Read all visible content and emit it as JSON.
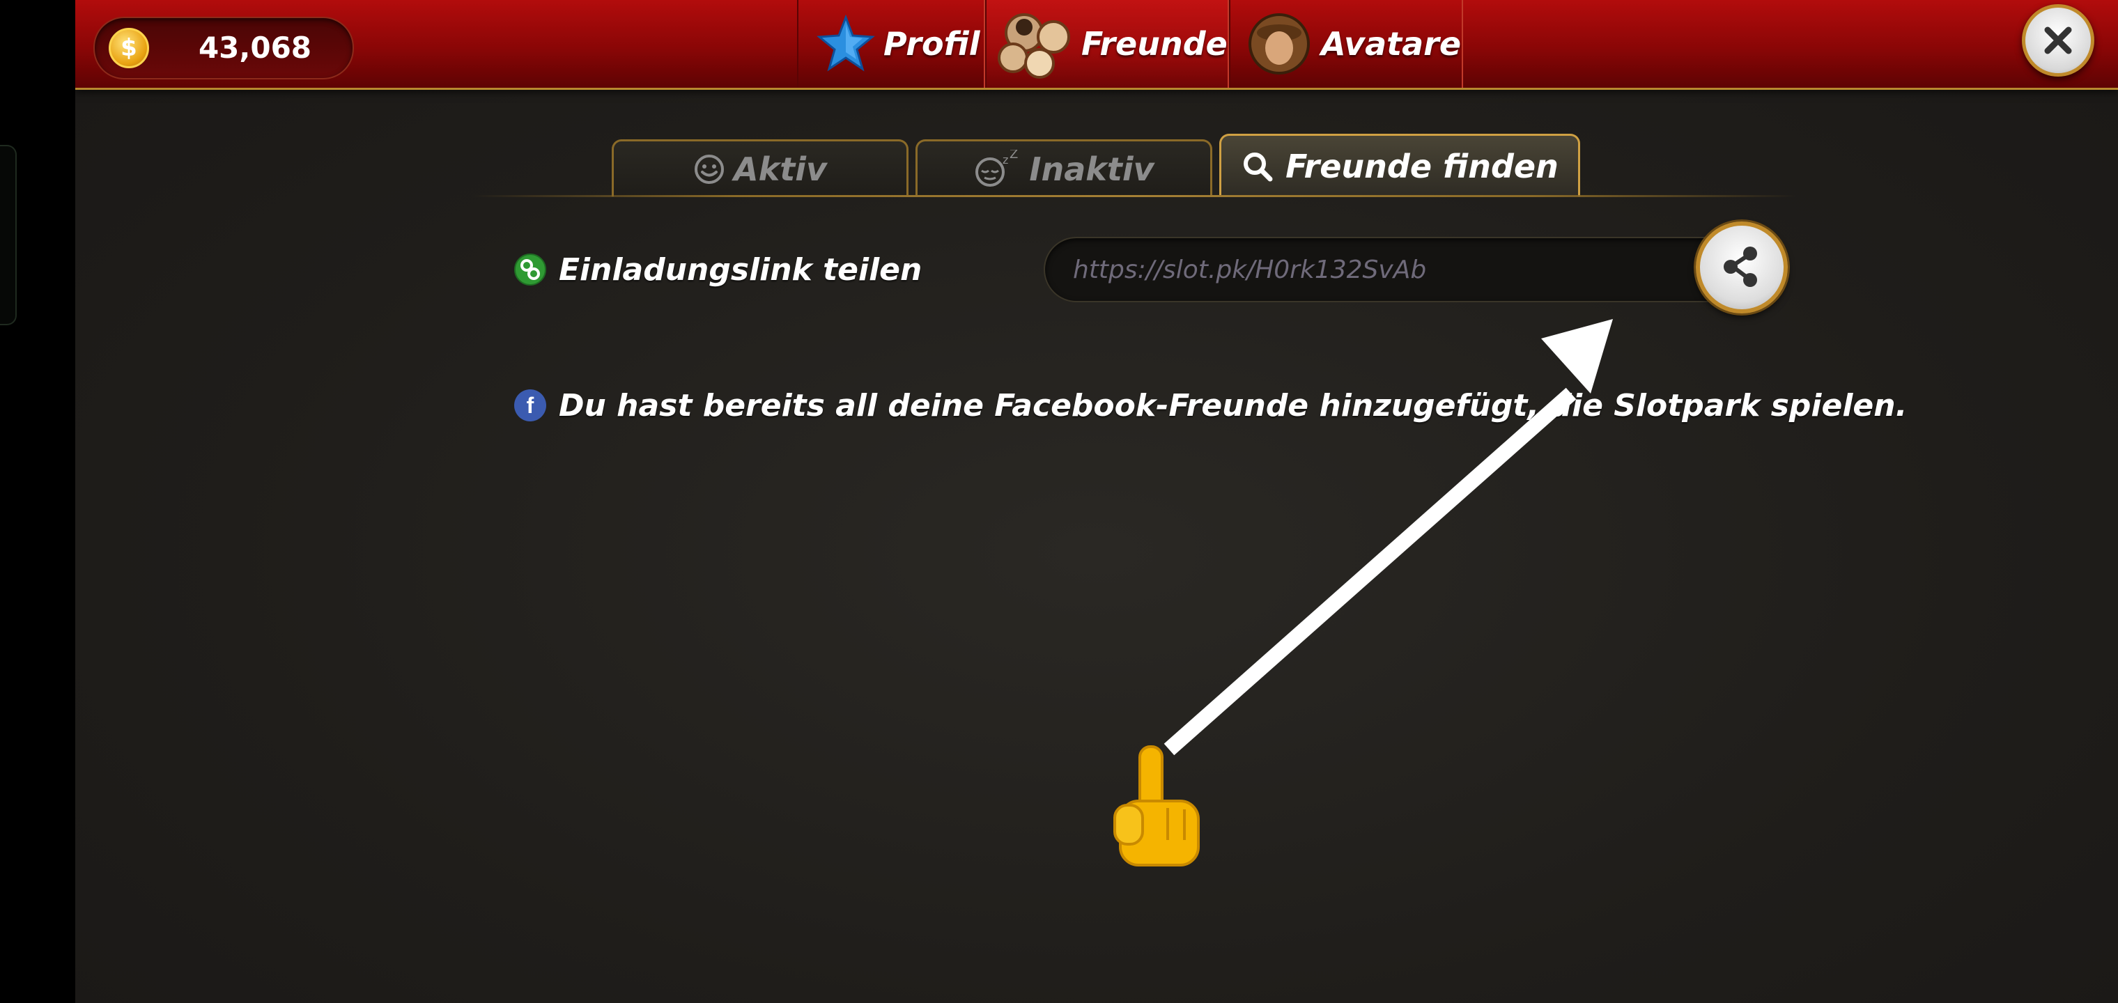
{
  "balance": {
    "value": "43,068",
    "icon": "dollar-coin-icon",
    "symbol": "$"
  },
  "nav": {
    "tabs": [
      {
        "label": "Profil",
        "icon": "blue-star-icon"
      },
      {
        "label": "Freunde",
        "icon": "friends-group-icon"
      },
      {
        "label": "Avatare",
        "icon": "avatar-portrait-icon"
      }
    ],
    "active": "Freunde",
    "close_icon": "close-x-icon"
  },
  "subtabs": {
    "items": [
      {
        "label": "Aktiv",
        "icon": "smiley-icon"
      },
      {
        "label": "Inaktiv",
        "icon": "sleepy-face-icon"
      },
      {
        "label": "Freunde finden",
        "icon": "search-icon"
      }
    ],
    "active": "Freunde finden"
  },
  "invite": {
    "label": "Einladungslink teilen",
    "link": "https://slot.pk/H0rk132SvAb",
    "icon": "link-icon",
    "share_icon": "share-icon"
  },
  "facebook": {
    "message": "Du hast bereits all deine Facebook-Freunde hinzugefügt, die Slotpark spielen.",
    "icon": "facebook-icon",
    "icon_glyph": "f"
  },
  "overlay": {
    "pointer": "pointing-hand-icon",
    "arrow": "arrow-icon"
  },
  "colors": {
    "accent_red": "#a40909",
    "gold": "#c08a2a",
    "background": "#1f1d1a"
  }
}
